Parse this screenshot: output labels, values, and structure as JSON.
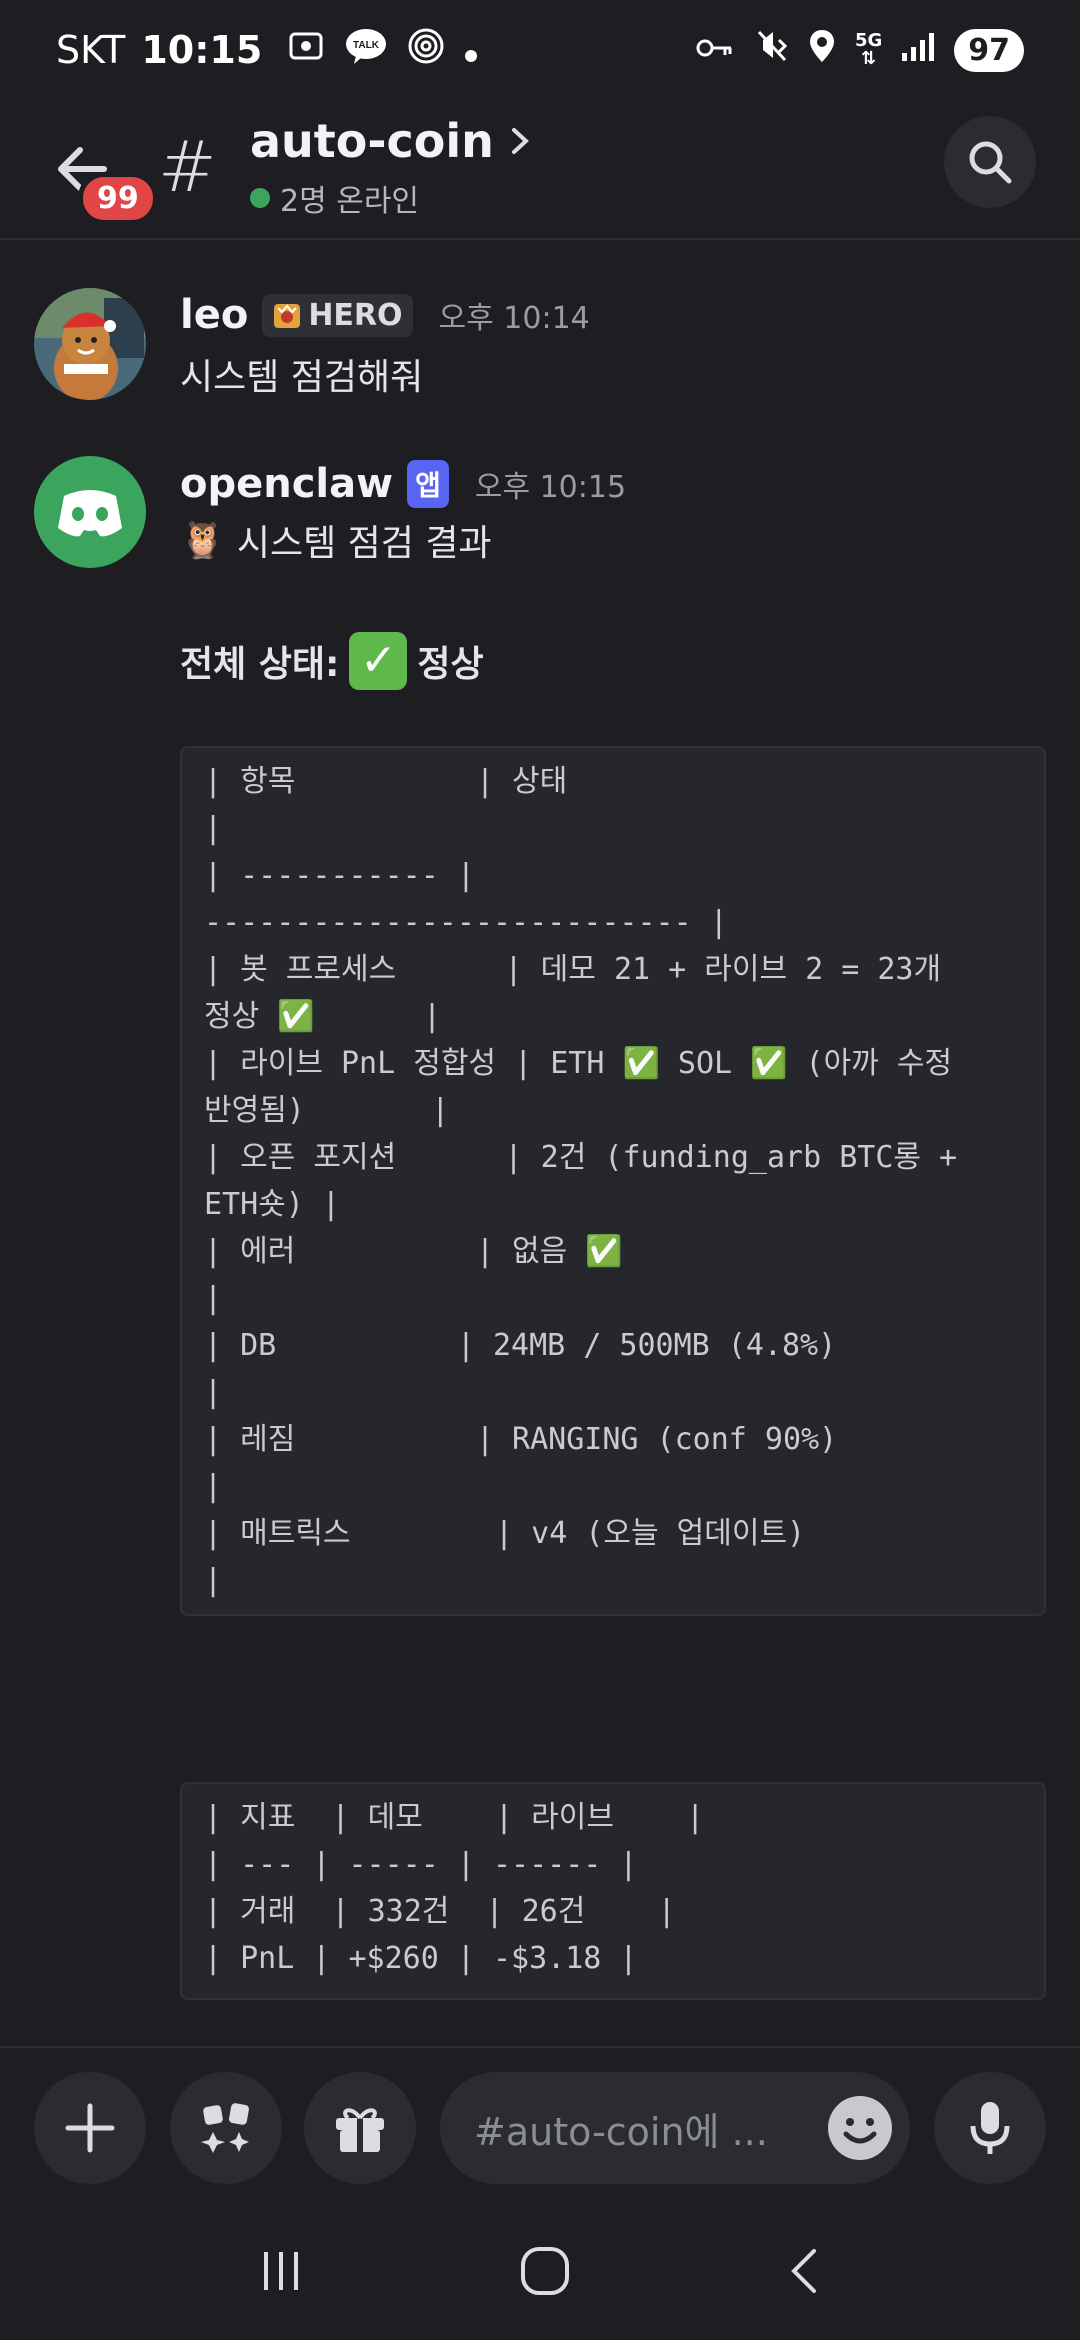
{
  "status_bar": {
    "carrier": "SKT",
    "time": "10:15",
    "talk_label": "TALK",
    "network": "5G",
    "battery": "97"
  },
  "header": {
    "unread_badge": "99",
    "channel_name": "auto-coin",
    "online_text": "2명 온라인"
  },
  "messages": [
    {
      "username": "leo",
      "badge": "HERO",
      "timestamp": "오후 10:14",
      "text": "시스템 점검해줘"
    },
    {
      "username": "openclaw",
      "badge": "앱",
      "timestamp": "오후 10:15",
      "title_emoji": "🦉",
      "title": "시스템 점검 결과",
      "status_label": "전체 상태:",
      "status_value": "정상",
      "code_block_1": [
        "| 항목          | 상태",
        "|",
        "| ----------- |",
        "--------------------------- |",
        "| 봇 프로세스      | 데모 21 + 라이브 2 = 23개",
        "정상 ✅      |",
        "| 라이브 PnL 정합성 | ETH ✅ SOL ✅ (아까 수정",
        "반영됨)       |",
        "| 오픈 포지션      | 2건 (funding_arb BTC롱 +",
        "ETH숏) |",
        "| 에러          | 없음 ✅",
        "|",
        "| DB          | 24MB / 500MB (4.8%)",
        "|",
        "| 레짐          | RANGING (conf 90%)",
        "|",
        "| 매트릭스        | v4 (오늘 업데이트)",
        "|"
      ],
      "code_block_2": [
        "| 지표  | 데모    | 라이브    |",
        "| --- | ----- | ------ |",
        "| 거래  | 332건  | 26건    |",
        "| PnL | +$260 | -$3.18 |"
      ]
    }
  ],
  "composer": {
    "placeholder": "#auto-coin에 ..."
  },
  "colors": {
    "background": "#1d1d22",
    "accent": "#5865f2",
    "online": "#3ba55d",
    "badge_red": "#e04646",
    "discord_avatar": "#3ba55d"
  },
  "icons": [
    "back-arrow-icon",
    "hash-icon",
    "chevron-right-icon",
    "search-icon",
    "plus-icon",
    "apps-icon",
    "gift-icon",
    "emoji-icon",
    "microphone-icon",
    "recents-icon",
    "home-icon",
    "back-icon"
  ]
}
